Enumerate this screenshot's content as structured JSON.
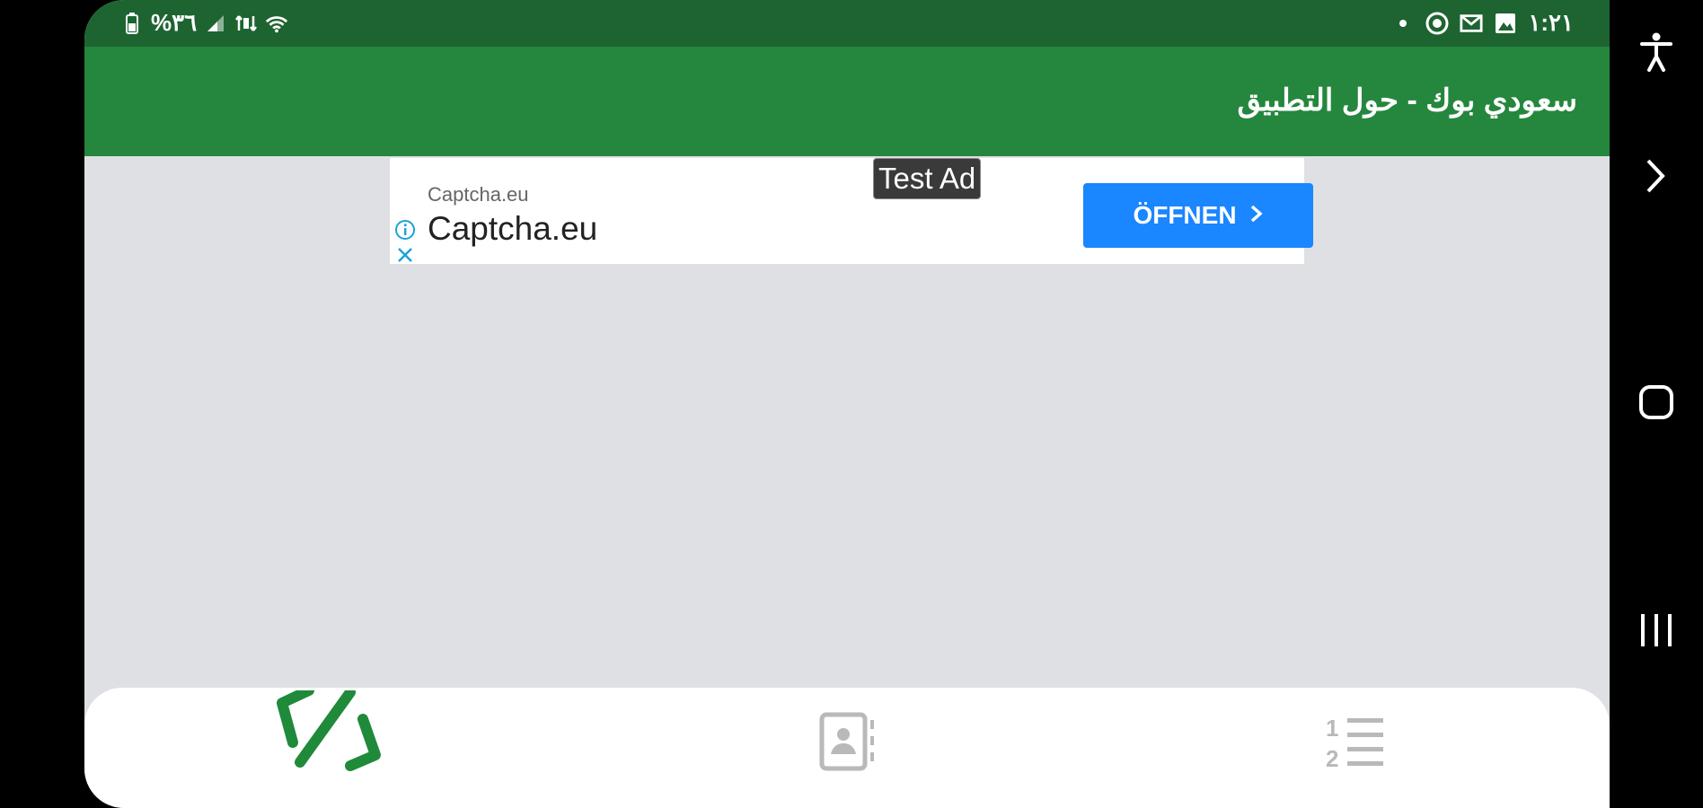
{
  "status_bar": {
    "battery_text": "%٣٦",
    "time": "١:٢١",
    "icons_left": [
      "battery-icon",
      "signal-icon",
      "data-icon",
      "wifi-icon"
    ],
    "icons_right": [
      "dot-icon",
      "app-notification-icon",
      "mail-icon",
      "gallery-icon"
    ]
  },
  "app_bar": {
    "title": "سعودي بوك -  حول التطبيق"
  },
  "ad": {
    "advertiser_small": "Captcha.eu",
    "advertiser_large": "Captcha.eu",
    "tag": "Test Ad",
    "cta_label": "ÖFFNEN",
    "cta_color": "#1a86ff"
  },
  "bottom_nav": {
    "items": [
      "code-icon",
      "contacts-icon",
      "numbered-list-icon"
    ],
    "active_color": "#1f8a3a",
    "inactive_color": "#b9b9b9"
  },
  "colors": {
    "status_bar": "#1d6431",
    "app_bar": "#24873d",
    "background": "#dfe0e3"
  },
  "system_nav": [
    "accessibility-icon",
    "forward-icon",
    "home-icon",
    "recents-icon"
  ]
}
